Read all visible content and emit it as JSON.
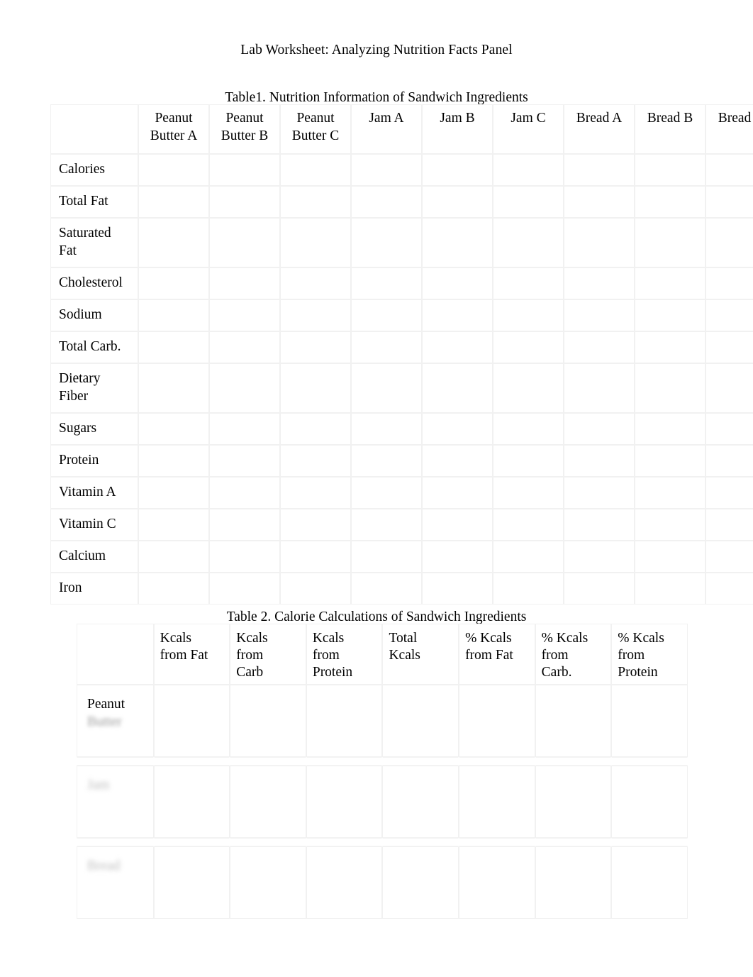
{
  "document": {
    "title": "Lab Worksheet: Analyzing Nutrition Facts Panel"
  },
  "table1": {
    "caption": "Table1.   Nutrition Information of Sandwich Ingredients",
    "corner_header": "",
    "column_headers": [
      "Peanut\nButter A",
      "Peanut\nButter B",
      "Peanut\nButter C",
      "Jam\nA",
      "Jam\nB",
      "Jam\nC",
      "Bread\nA",
      "Bread\nB",
      "Bread\nC"
    ],
    "row_labels": [
      "Calories",
      "Total Fat",
      "Saturated\nFat",
      "Cholesterol",
      "Sodium",
      "Total Carb.",
      "Dietary\nFiber",
      "Sugars",
      "Protein",
      "Vitamin A",
      "Vitamin C",
      "Calcium",
      "Iron"
    ],
    "cells": [
      [
        "",
        "",
        "",
        "",
        "",
        "",
        "",
        "",
        ""
      ],
      [
        "",
        "",
        "",
        "",
        "",
        "",
        "",
        "",
        ""
      ],
      [
        "",
        "",
        "",
        "",
        "",
        "",
        "",
        "",
        ""
      ],
      [
        "",
        "",
        "",
        "",
        "",
        "",
        "",
        "",
        ""
      ],
      [
        "",
        "",
        "",
        "",
        "",
        "",
        "",
        "",
        ""
      ],
      [
        "",
        "",
        "",
        "",
        "",
        "",
        "",
        "",
        ""
      ],
      [
        "",
        "",
        "",
        "",
        "",
        "",
        "",
        "",
        ""
      ],
      [
        "",
        "",
        "",
        "",
        "",
        "",
        "",
        "",
        ""
      ],
      [
        "",
        "",
        "",
        "",
        "",
        "",
        "",
        "",
        ""
      ],
      [
        "",
        "",
        "",
        "",
        "",
        "",
        "",
        "",
        ""
      ],
      [
        "",
        "",
        "",
        "",
        "",
        "",
        "",
        "",
        ""
      ],
      [
        "",
        "",
        "",
        "",
        "",
        "",
        "",
        "",
        ""
      ],
      [
        "",
        "",
        "",
        "",
        "",
        "",
        "",
        "",
        ""
      ]
    ]
  },
  "table2": {
    "caption": "Table 2.   Calorie Calculations of Sandwich Ingredients",
    "corner_header": "",
    "column_headers": [
      "Kcals\nfrom Fat",
      "Kcals\nfrom\nCarb",
      "Kcals\nfrom\nProtein",
      "Total\nKcals",
      "% Kcals\nfrom Fat",
      "% Kcals\nfrom\nCarb.",
      "% Kcals\nfrom\nProtein"
    ],
    "row_labels": [
      {
        "line1": "Peanut",
        "line2": "Butter",
        "line1_blurred": false,
        "line2_blurred": true
      },
      {
        "line1": "Jam",
        "line2": "",
        "line1_blurred": true,
        "line2_blurred": false
      },
      {
        "line1": "Bread",
        "line2": "",
        "line1_blurred": true,
        "line2_blurred": false
      }
    ],
    "cells": [
      [
        "",
        "",
        "",
        "",
        "",
        "",
        ""
      ],
      [
        "",
        "",
        "",
        "",
        "",
        "",
        ""
      ],
      [
        "",
        "",
        "",
        "",
        "",
        "",
        ""
      ]
    ]
  }
}
